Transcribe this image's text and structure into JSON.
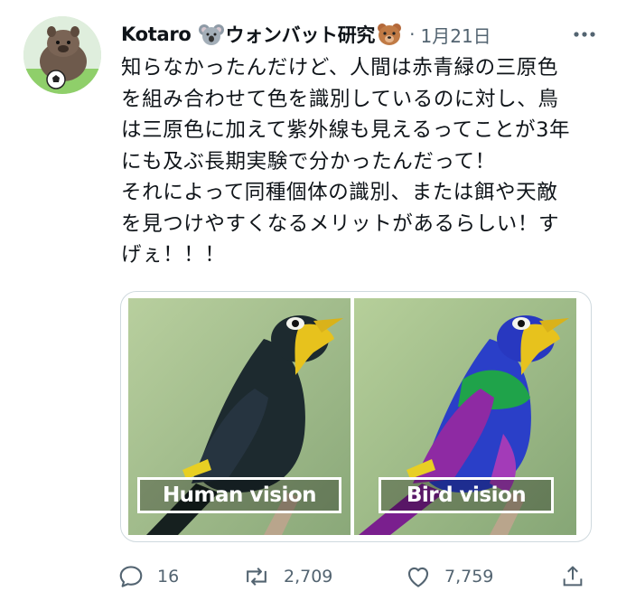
{
  "author": {
    "name": "Kotaro",
    "handle_suffix": "ウォンバット研究",
    "emoji_before": "koala-emoji",
    "emoji_after": "bear-emoji"
  },
  "meta": {
    "separator": "·",
    "date": "1月21日",
    "more_icon": "more-horizontal-icon"
  },
  "tweet": {
    "text": "知らなかったんだけど、人間は赤青緑の三原色\nを組み合わせて色を識別しているのに対し、鳥\nは三原色に加えて紫外線も見えるってことが3年\nにも及ぶ長期実験で分かったんだって！\nそれによって同種個体の識別、または餌や天敵\nを見つけやすくなるメリットがあるらしい！す\nげぇ！！！"
  },
  "media": {
    "left_caption": "Human vision",
    "right_caption": "Bird vision",
    "colors": {
      "background_green": "#9fbf86",
      "human_bird_body": "#1d2a2f",
      "bird_blue": "#2a3fc8",
      "bird_green": "#1fa34a",
      "bird_purple": "#8e2aa3",
      "bill_yellow": "#e7c21d"
    }
  },
  "actions": {
    "reply": {
      "icon": "reply-icon",
      "count": "16"
    },
    "retweet": {
      "icon": "retweet-icon",
      "count": "2,709"
    },
    "like": {
      "icon": "heart-icon",
      "count": "7,759"
    },
    "share": {
      "icon": "share-icon"
    }
  }
}
